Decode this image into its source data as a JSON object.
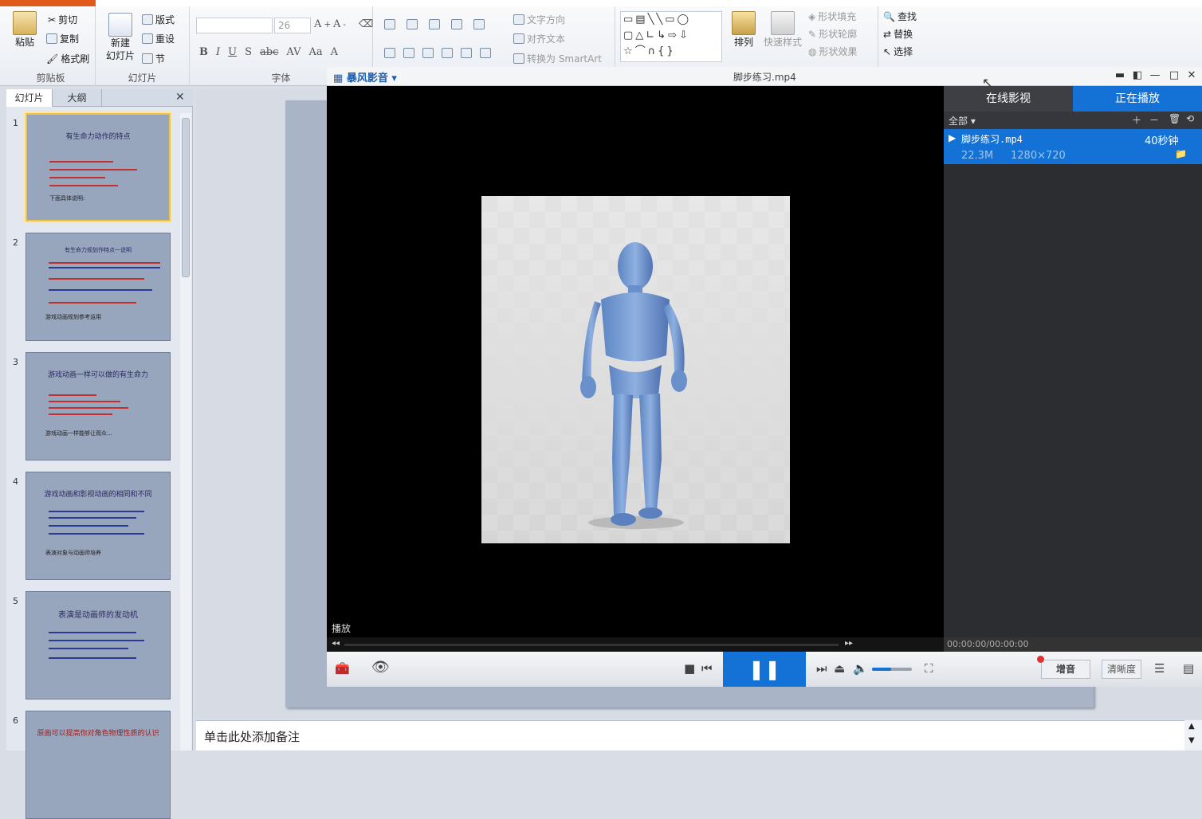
{
  "ribbon": {
    "clipboard": {
      "paste": "粘贴",
      "cut": "剪切",
      "copy": "复制",
      "format_painter": "格式刷",
      "label": "剪贴板"
    },
    "slides": {
      "new_slide": "新建\n幻灯片",
      "layout": "版式",
      "reset": "重设",
      "section": "节",
      "label": "幻灯片"
    },
    "font": {
      "size": "26",
      "label": "字体",
      "bold": "B",
      "italic": "I",
      "underline": "U",
      "shadow": "S",
      "strike": "abc",
      "spacing": "AV",
      "case": "Aa",
      "color": "A"
    },
    "paragraph": {
      "text_direction": "文字方向",
      "align_text": "对齐文本",
      "smartart": "转换为 SmartArt"
    },
    "drawing": {
      "arrange": "排列",
      "quick_styles": "快速样式",
      "fill": "形状填充",
      "outline": "形状轮廓",
      "effects": "形状效果"
    },
    "editing": {
      "find": "查找",
      "replace": "替换",
      "select": "选择"
    }
  },
  "left_pane": {
    "tab_slides": "幻灯片",
    "tab_outline": "大纲",
    "close": "✕",
    "slides": [
      {
        "num": "1",
        "title": "有生命力动作的特点",
        "foot": "下面具体说明:"
      },
      {
        "num": "2",
        "title": "有生命力规划作特点一说明",
        "foot": "游戏动画规划参考运用"
      },
      {
        "num": "3",
        "title": "游戏动画一样可以做的有生命力",
        "foot": "游戏动画一样能够让观众..."
      },
      {
        "num": "4",
        "title": "游戏动画和影视动画的相同和不同",
        "foot": "表演对象与动画师培养"
      },
      {
        "num": "5",
        "title": "表演是动画师的发动机",
        "foot": ""
      },
      {
        "num": "6",
        "title": "原画可以提高你对角色物理性质的认识",
        "foot": ""
      }
    ]
  },
  "notes": {
    "placeholder": "单击此处添加备注"
  },
  "player": {
    "brand": "暴风影音",
    "title": "脚步练习.mp4",
    "status": "播放",
    "time": "00:00:00/00:00:00",
    "tab_online": "在线影视",
    "tab_playing": "正在播放",
    "filter": "全部",
    "item": {
      "name": "脚步练习.mp4",
      "duration": "40秒钟",
      "size": "22.3M",
      "resolution": "1280×720"
    },
    "enhance_label": "增音",
    "clarity_label": "清晰度"
  },
  "colors": {
    "accent": "#1472d6",
    "selection": "#f1c24a"
  }
}
